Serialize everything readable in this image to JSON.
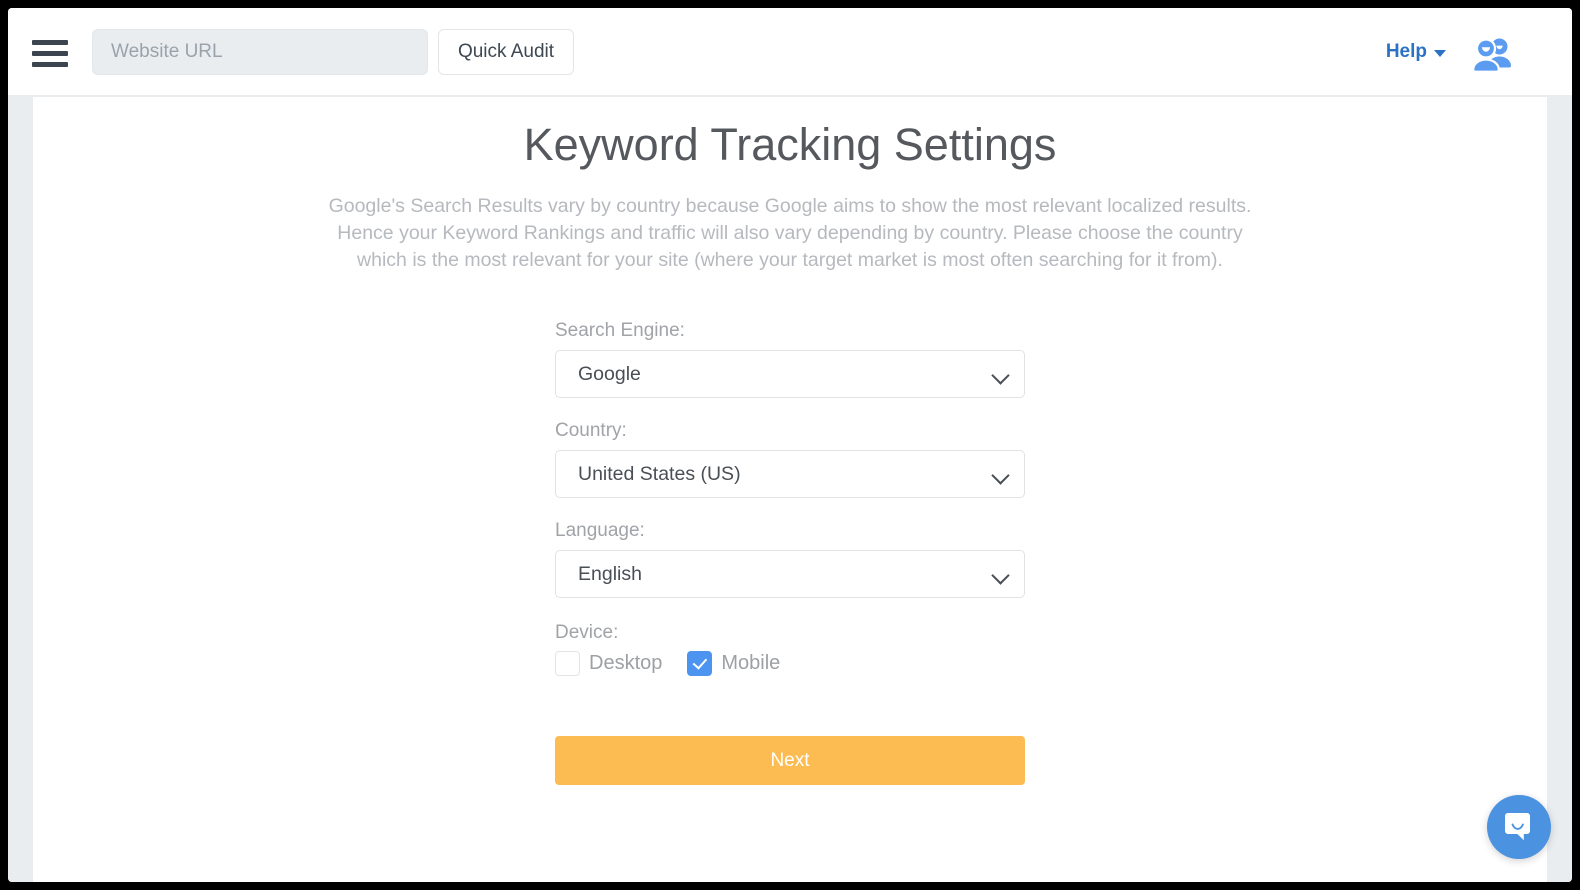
{
  "topbar": {
    "menu_icon": "hamburger-menu-icon",
    "url_input": {
      "value": "",
      "placeholder": "Website URL"
    },
    "quick_audit_label": "Quick Audit",
    "help_label": "Help",
    "help_caret_icon": "chevron-down-icon",
    "account_icon": "users-icon"
  },
  "main": {
    "title": "Keyword Tracking Settings",
    "description": "Google's Search Results vary by country because Google aims to show the most relevant localized results. Hence your Keyword Rankings and traffic will also vary depending by country. Please choose the country which is the most relevant for your site (where your target market is most often searching for it from).",
    "fields": [
      {
        "label": "Search Engine:",
        "value": "Google",
        "caret_icon": "chevron-down-icon"
      },
      {
        "label": "Country:",
        "value": "United States (US)",
        "caret_icon": "chevron-down-icon"
      },
      {
        "label": "Language:",
        "value": "English",
        "caret_icon": "chevron-down-icon"
      }
    ],
    "device": {
      "label": "Device:",
      "options": [
        {
          "label": "Desktop",
          "checked": false
        },
        {
          "label": "Mobile",
          "checked": true
        }
      ]
    },
    "next_label": "Next"
  },
  "chat": {
    "launcher_icon": "chat-bubble-icon"
  },
  "colors": {
    "accent_blue": "#2b72c2",
    "checkbox_blue": "#4d94f0",
    "next_orange": "#fcbc51",
    "chat_blue": "#4b92e0",
    "page_gutter": "#e9edf0"
  }
}
